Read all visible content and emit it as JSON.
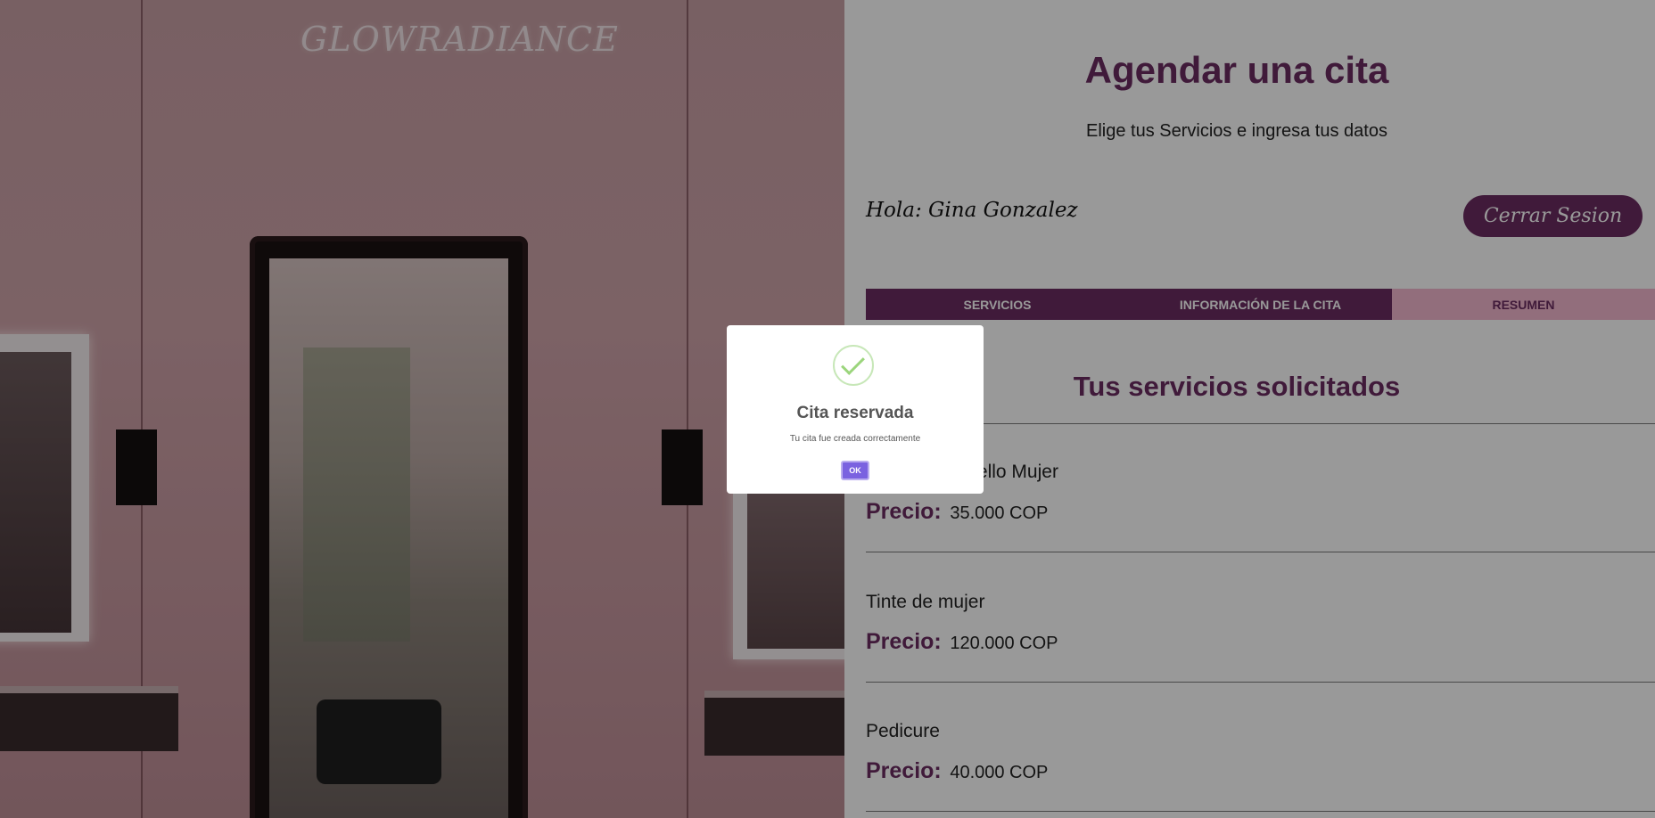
{
  "brand": {
    "name": "GLOWRADIANCE"
  },
  "header": {
    "title": "Agendar una cita",
    "subtitle": "Elige tus Servicios e ingresa tus datos"
  },
  "user": {
    "greeting": "Hola: Gina Gonzalez",
    "logout_label": "Cerrar Sesion"
  },
  "tabs": [
    {
      "label": "SERVICIOS",
      "active": false
    },
    {
      "label": "INFORMACIÓN DE LA CITA",
      "active": false
    },
    {
      "label": "RESUMEN",
      "active": true
    }
  ],
  "summary": {
    "title": "Tus servicios solicitados",
    "price_label": "Precio:",
    "services": [
      {
        "name": "Corte de Cabello Mujer",
        "price": "35.000 COP"
      },
      {
        "name": "Tinte de mujer",
        "price": "120.000 COP"
      },
      {
        "name": "Pedicure",
        "price": "40.000 COP"
      }
    ]
  },
  "modal": {
    "icon": "success-check-icon",
    "title": "Cita reservada",
    "text": "Tu cita fue creada correctamente",
    "ok_label": "OK"
  },
  "colors": {
    "brand": "#6b2c61",
    "tab_active": "#f3b8cf",
    "confirm_button": "#7a62e0",
    "success": "#9bd57c"
  }
}
